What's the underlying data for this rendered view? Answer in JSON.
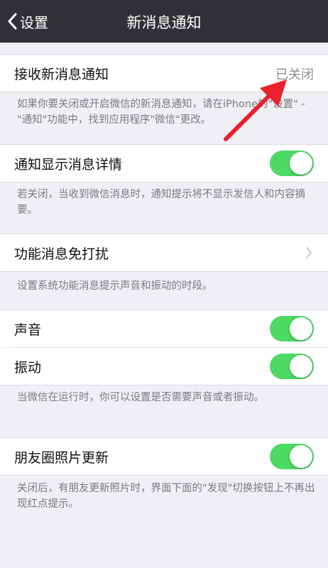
{
  "nav": {
    "back_label": "设置",
    "title": "新消息通知"
  },
  "sections": {
    "receive": {
      "label": "接收新消息通知",
      "value": "已关闭",
      "note": "如果你要关闭或开启微信的新消息通知，请在iPhone的\"设置\" - \"通知\"功能中，找到应用程序\"微信\"更改。"
    },
    "details": {
      "label": "通知显示消息详情",
      "on": true,
      "note": "若关闭，当收到微信消息时，通知提示将不显示发信人和内容摘要。"
    },
    "dnd": {
      "label": "功能消息免打扰",
      "note": "设置系统功能消息提示声音和振动的时段。"
    },
    "sound": {
      "label": "声音",
      "on": true
    },
    "vibrate": {
      "label": "振动",
      "on": true,
      "note": "当微信在运行时，你可以设置是否需要声音或者振动。"
    },
    "moments": {
      "label": "朋友圈照片更新",
      "on": true,
      "note": "关闭后，有朋友更新照片时，界面下面的\"发现\"切换按钮上不再出现红点提示。"
    }
  },
  "colors": {
    "nav_bg": "#303134",
    "toggle_on": "#4cd964",
    "annotation_arrow": "#e8212d"
  }
}
